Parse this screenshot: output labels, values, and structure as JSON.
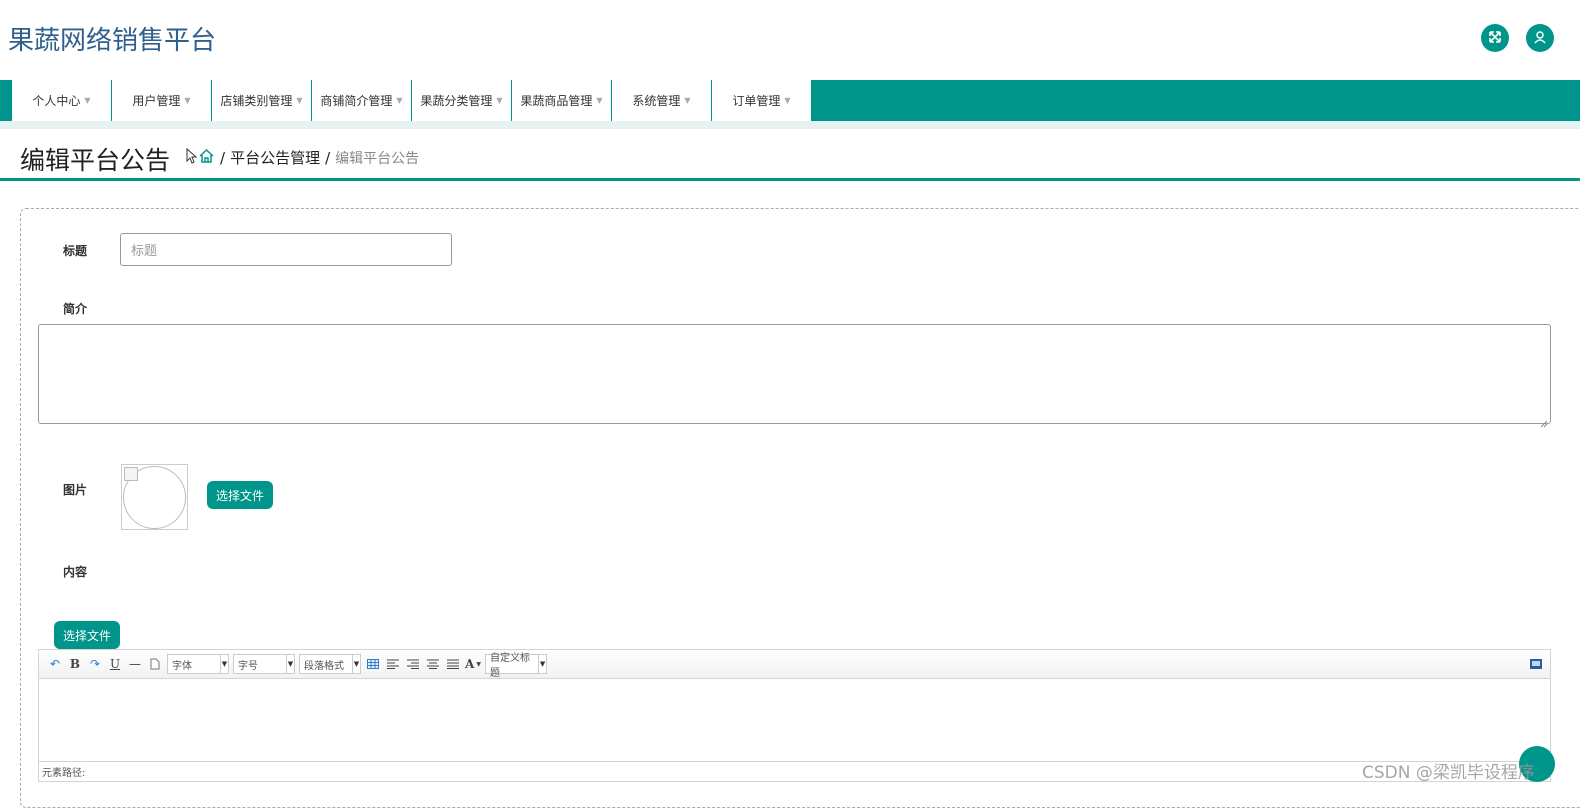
{
  "header": {
    "brand": "果蔬网络销售平台",
    "icons": [
      "fullscreen-icon",
      "user-icon"
    ]
  },
  "nav": {
    "items": [
      {
        "label": "个人中心"
      },
      {
        "label": "用户管理"
      },
      {
        "label": "店铺类别管理"
      },
      {
        "label": "商铺简介管理"
      },
      {
        "label": "果蔬分类管理"
      },
      {
        "label": "果蔬商品管理"
      },
      {
        "label": "系统管理"
      },
      {
        "label": "订单管理"
      }
    ]
  },
  "breadcrumb": {
    "page_title": "编辑平台公告",
    "separator": "/",
    "parent": "平台公告管理",
    "current": "编辑平台公告"
  },
  "form": {
    "title_label": "标题",
    "title_placeholder": "标题",
    "intro_label": "简介",
    "image_label": "图片",
    "image_button": "选择文件",
    "content_label": "内容",
    "content_button": "选择文件"
  },
  "editor": {
    "font_select": "字体",
    "size_select": "字号",
    "paragraph_select": "段落格式",
    "custom_title_select": "自定义标题",
    "path_label": "元素路径:"
  },
  "watermark": "CSDN @梁凯毕设程序",
  "colors": {
    "primary": "#00958a",
    "brand_text": "#2f5f8f"
  }
}
